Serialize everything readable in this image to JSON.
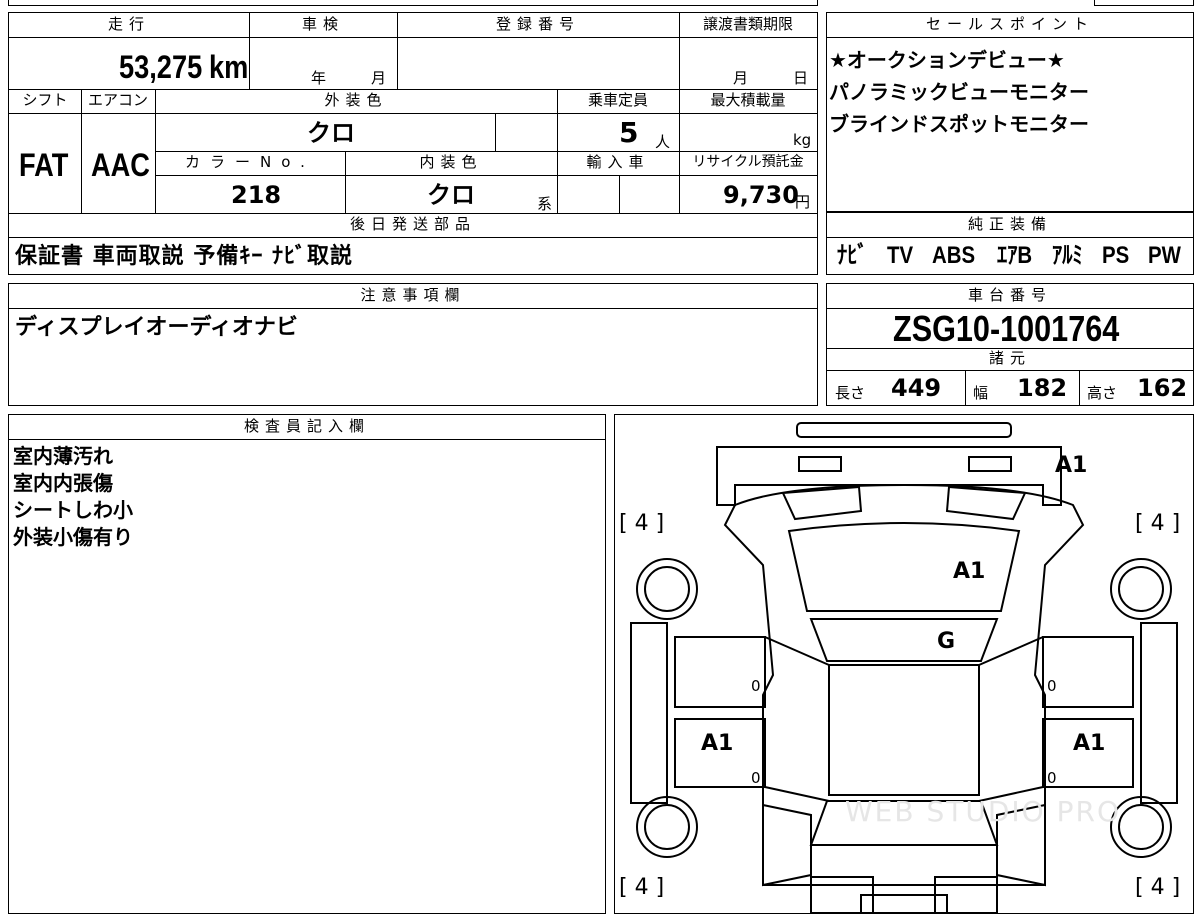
{
  "vehicle": {
    "headers": {
      "mileage": "走行",
      "inspection": "車検",
      "registration": "登録番号",
      "transfer_deadline": "譲渡書類期限",
      "shift": "シフト",
      "aircon": "エアコン",
      "exterior_color": "外装色",
      "capacity": "乗車定員",
      "max_load": "最大積載量",
      "color_no": "カラーNo.",
      "interior_color": "内装色",
      "import": "輸入車",
      "recycle": "リサイクル預託金",
      "later_parts": "後日発送部品"
    },
    "mileage": "53,275",
    "mileage_unit": "km",
    "inspection_year_unit": "年",
    "inspection_month_unit": "月",
    "transfer_month_unit": "月",
    "transfer_day_unit": "日",
    "shift": "FAT",
    "aircon": "AAC",
    "exterior_color": "クロ",
    "capacity": "5",
    "capacity_unit": "人",
    "max_load_unit": "kg",
    "color_no": "218",
    "interior_color": "クロ",
    "interior_suffix": "系",
    "recycle_fee": "9,730",
    "recycle_unit": "円",
    "later_parts": "保証書 車両取説 予備ｷｰ ﾅﾋﾞ取説"
  },
  "sales": {
    "header": "セールスポイント",
    "points": [
      "★オークションデビュー★",
      "パノラミックビューモニター",
      "ブラインドスポットモニター"
    ]
  },
  "equipment": {
    "header": "純正装備",
    "items": [
      "ﾅﾋﾞ",
      "TV",
      "ABS",
      "ｴｱB",
      "ｱﾙﾐ",
      "PS",
      "PW"
    ]
  },
  "notes": {
    "header": "注意事項欄",
    "text": "ディスプレイオーディオナビ"
  },
  "chassis": {
    "header": "車台番号",
    "number": "ZSG10-1001764",
    "spec_header": "諸元",
    "length_label": "長さ",
    "length": "449",
    "width_label": "幅",
    "width": "182",
    "height_label": "高さ",
    "height": "162"
  },
  "inspector": {
    "header": "検査員記入欄",
    "lines": [
      "室内薄汚れ",
      "室内内張傷",
      "シートしわ小",
      "外装小傷有り"
    ]
  },
  "diagram": {
    "tire_tl": "[ 4 ]",
    "tire_tr": "[ 4 ]",
    "tire_bl": "[ 4 ]",
    "tire_br": "[ 4 ]",
    "mark_front": "A1",
    "mark_hood": "A1",
    "mark_windshield": "G",
    "mark_left_door": "A1",
    "mark_right_door": "A1",
    "door_mark_l1": "0",
    "door_mark_l2": "0",
    "door_mark_r1": "0",
    "door_mark_r2": "0",
    "watermark": "WEB STUDIO PRO"
  }
}
